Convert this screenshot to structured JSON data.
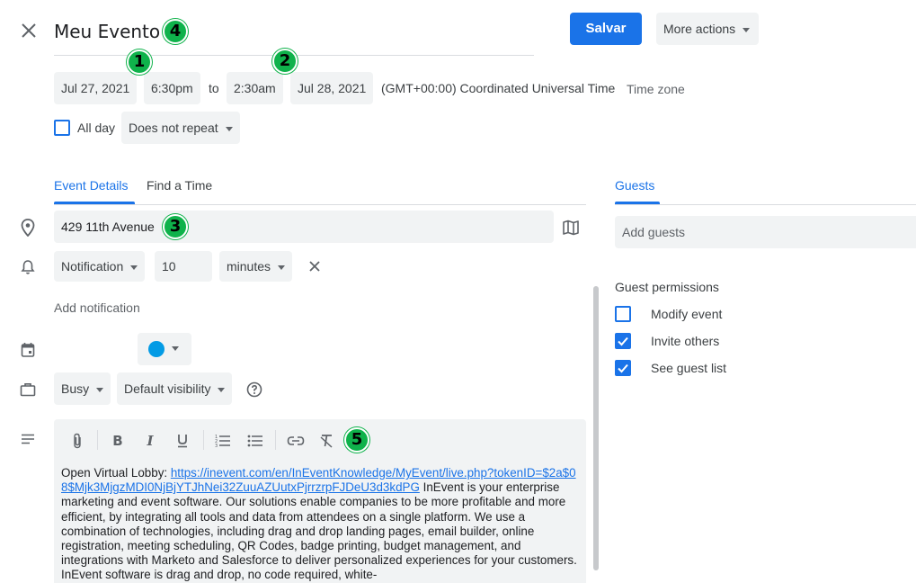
{
  "header": {
    "title": "Meu Evento",
    "save_label": "Salvar",
    "more_actions_label": "More actions"
  },
  "datetime": {
    "start_date": "Jul 27, 2021",
    "start_time": "6:30pm",
    "to_label": "to",
    "end_time": "2:30am",
    "end_date": "Jul 28, 2021",
    "timezone_text": "(GMT+00:00) Coordinated Universal Time",
    "timezone_link": "Time zone"
  },
  "allday": {
    "label": "All day",
    "checked": false,
    "repeat_label": "Does not repeat"
  },
  "tabs": [
    {
      "label": "Event Details",
      "active": true
    },
    {
      "label": "Find a Time",
      "active": false
    }
  ],
  "location": {
    "value": "429 11th Avenue"
  },
  "notification": {
    "type_label": "Notification",
    "amount": "10",
    "unit_label": "minutes",
    "add_label": "Add notification"
  },
  "calendar": {
    "color": "#039be5"
  },
  "availability": {
    "busy_label": "Busy",
    "visibility_label": "Default visibility"
  },
  "description": {
    "prefix": "Open Virtual Lobby: ",
    "link": "https://inevent.com/en/InEventKnowledge/MyEvent/live.php?tokenID=$2a$08$Mjk3MjgzMDI0NjBjYTJhNei32ZuuAZUutxPjrrzrpFJDeU3d3kdPG",
    "body": " InEvent is your enterprise marketing and event software. Our solutions enable companies to be more profitable and more efficient, by integrating all tools and data from attendees on a single platform. We use a combination of technologies, including drag and drop landing pages, email builder, online registration, meeting scheduling, QR Codes, badge printing, budget management, and integrations with Marketo and Salesforce to deliver personalized experiences for your customers. InEvent software is drag and drop, no code required, white-"
  },
  "guests": {
    "tab_label": "Guests",
    "add_placeholder": "Add guests",
    "permissions_title": "Guest permissions",
    "permissions": [
      {
        "label": "Modify event",
        "checked": false
      },
      {
        "label": "Invite others",
        "checked": true
      },
      {
        "label": "See guest list",
        "checked": true
      }
    ]
  },
  "badges": [
    "1",
    "2",
    "3",
    "4",
    "5"
  ],
  "colors": {
    "primary": "#1a73e8",
    "badge": "#0fb24b",
    "chip_bg": "#f1f3f4"
  }
}
